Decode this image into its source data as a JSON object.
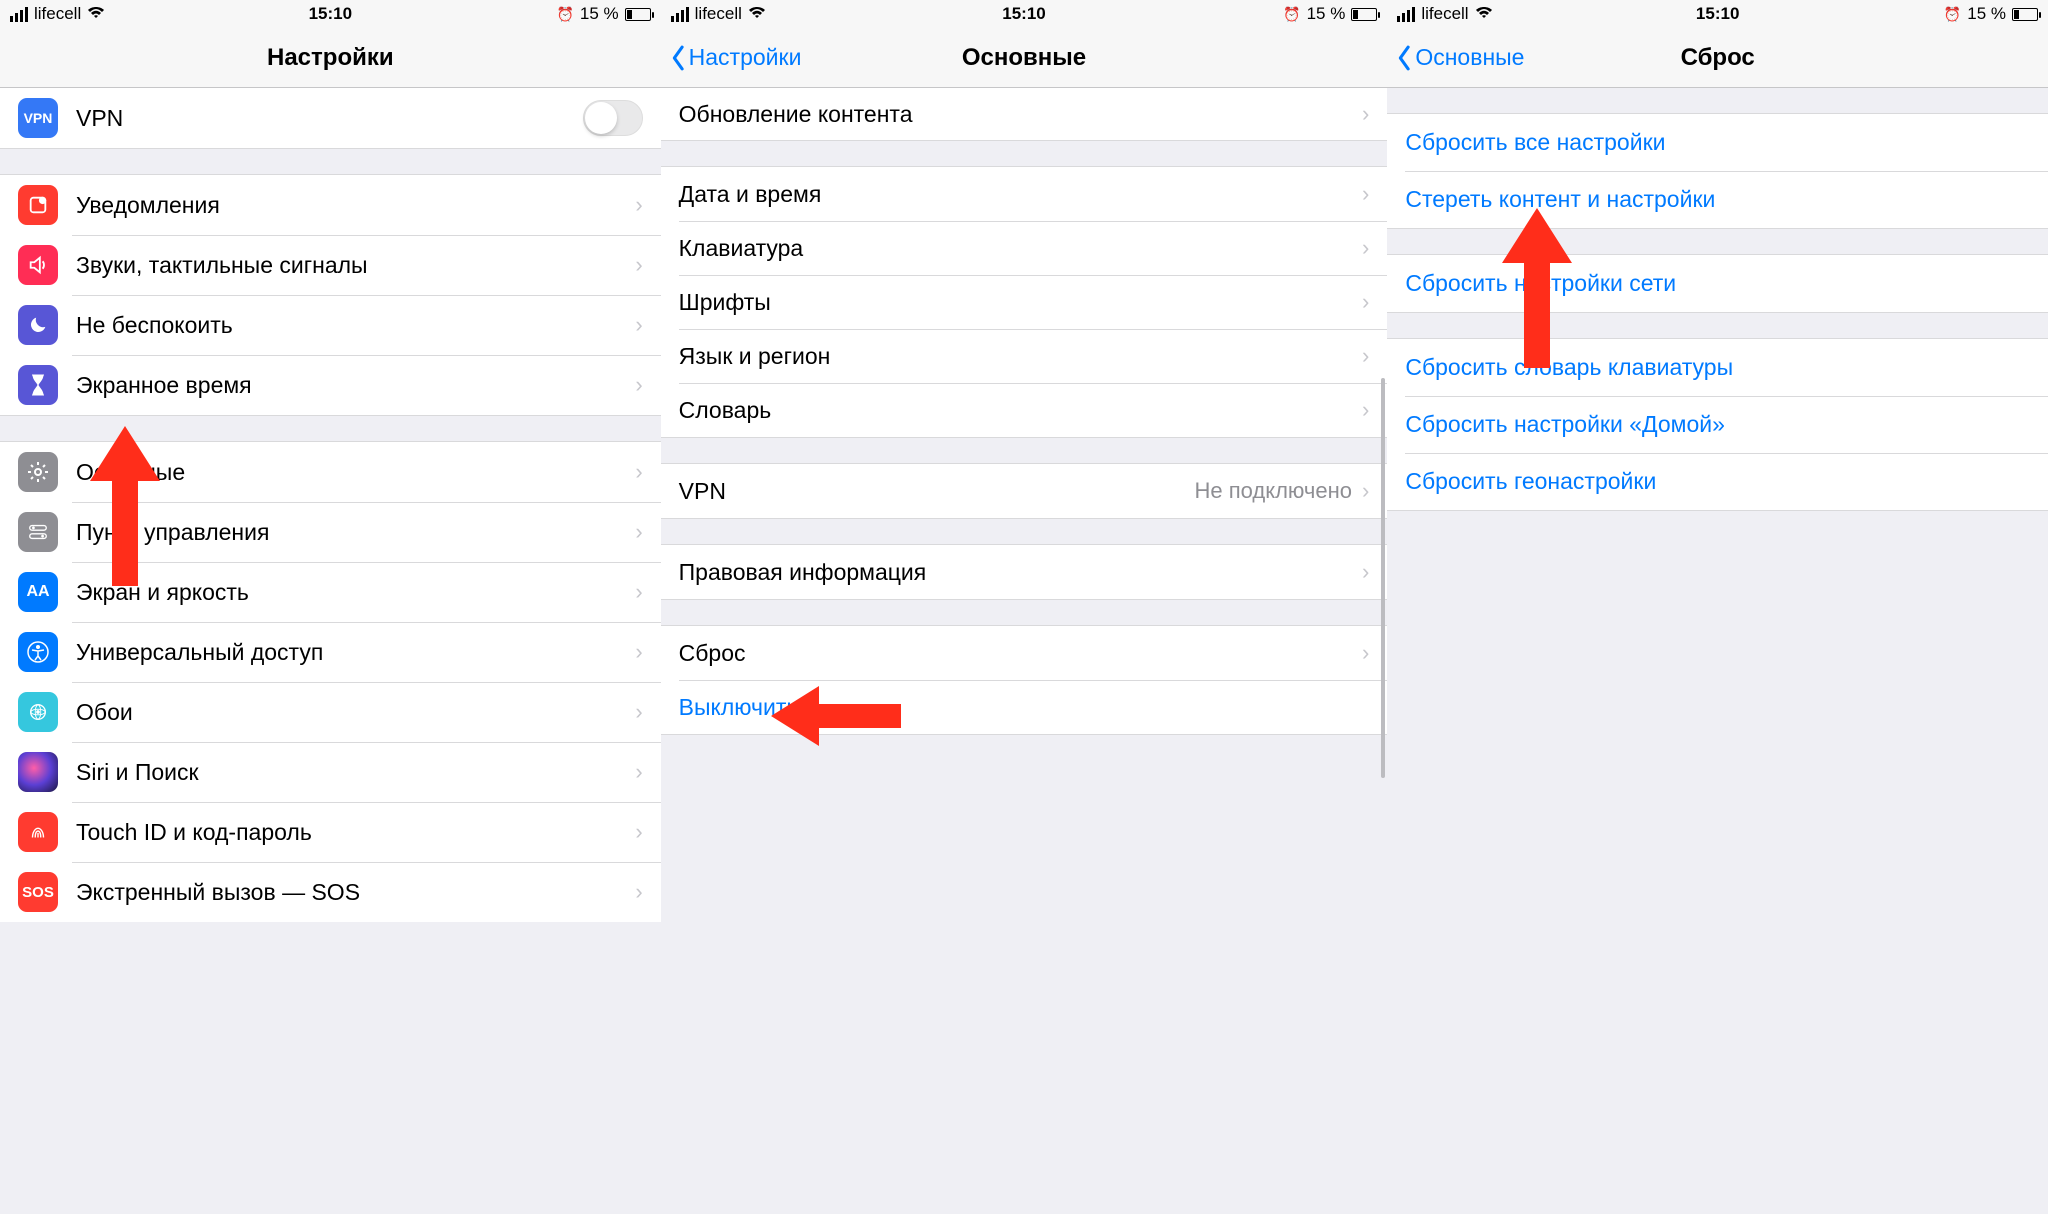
{
  "status": {
    "carrier": "lifecell",
    "time": "15:10",
    "battery": "15 %"
  },
  "screen1": {
    "title": "Настройки",
    "vpn": "VPN",
    "notifications": "Уведомления",
    "sounds": "Звуки, тактильные сигналы",
    "dnd": "Не беспокоить",
    "screentime": "Экранное время",
    "general": "Основные",
    "controlcenter": "Пункт управления",
    "display": "Экран и яркость",
    "accessibility": "Универсальный доступ",
    "wallpaper": "Обои",
    "siri": "Siri и Поиск",
    "touchid": "Touch ID и код-пароль",
    "sos": "Экстренный вызов — SOS"
  },
  "screen2": {
    "back": "Настройки",
    "title": "Основные",
    "refresh": "Обновление контента",
    "datetime": "Дата и время",
    "keyboard": "Клавиатура",
    "fonts": "Шрифты",
    "lang": "Язык и регион",
    "dict": "Словарь",
    "vpn": "VPN",
    "vpnval": "Не подключено",
    "legal": "Правовая информация",
    "reset": "Сброс",
    "shutdown": "Выключить"
  },
  "screen3": {
    "back": "Основные",
    "title": "Сброс",
    "resetall": "Сбросить все настройки",
    "erase": "Стереть контент и настройки",
    "resetnet": "Сбросить настройки сети",
    "resetdict": "Сбросить словарь клавиатуры",
    "resethome": "Сбросить настройки «Домой»",
    "resetloc": "Сбросить геонастройки"
  }
}
